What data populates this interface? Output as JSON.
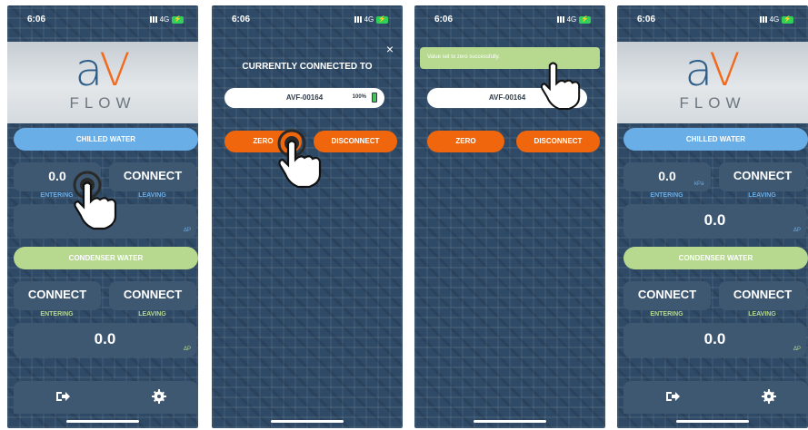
{
  "status": {
    "time": "6:06",
    "network": "4G"
  },
  "logo": {
    "letter_a": "a",
    "letter_v": "V",
    "word": "FLOW"
  },
  "phone1": {
    "chilled_label": "CHILLED WATER",
    "chilled_entering_value": "0.0",
    "chilled_leaving_value": "CONNECT",
    "entering_label": "ENTERING",
    "leaving_label": "LEAVING",
    "chilled_delta_value": "0.0",
    "delta_label": "ΔP",
    "condenser_label": "CONDENSER WATER",
    "condenser_entering_value": "CONNECT",
    "condenser_leaving_value": "CONNECT",
    "condenser_delta_value": "0.0"
  },
  "phone2": {
    "title": "CURRENTLY CONNECTED TO",
    "close": "×",
    "device_name": "AVF-00164",
    "battery_pct": "100%",
    "zero_label": "ZERO",
    "disconnect_label": "DISCONNECT"
  },
  "phone3": {
    "toast": "Value set to zero successfully.",
    "device_name": "AVF-00164",
    "zero_label": "ZERO",
    "disconnect_label": "DISCONNECT"
  },
  "phone4": {
    "chilled_label": "CHILLED WATER",
    "chilled_entering_value": "0.0",
    "unit": "kPa",
    "chilled_leaving_value": "CONNECT",
    "entering_label": "ENTERING",
    "leaving_label": "LEAVING",
    "chilled_delta_value": "0.0",
    "delta_label": "ΔP",
    "condenser_label": "CONDENSER WATER",
    "condenser_entering_value": "CONNECT",
    "condenser_leaving_value": "CONNECT",
    "condenser_delta_value": "0.0"
  },
  "colors": {
    "background": "#2f4a66",
    "chilled": "#6aaee8",
    "condenser": "#b6d98f",
    "action": "#f0660c"
  }
}
